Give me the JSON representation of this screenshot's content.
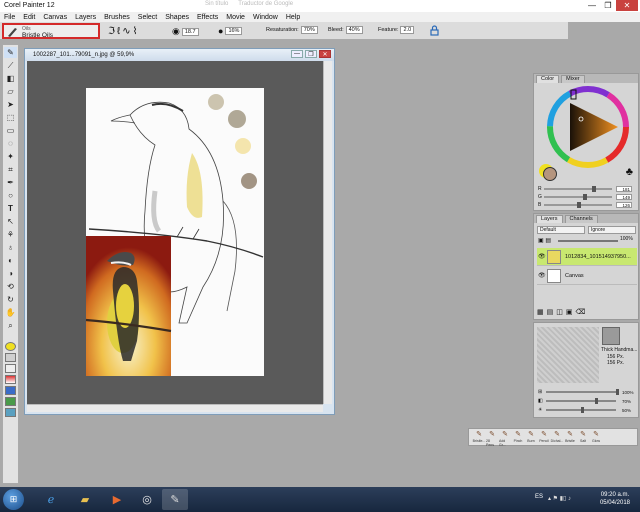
{
  "window": {
    "title": "Corel Painter 12",
    "ghost_tabs": [
      "Sin título",
      "Traductor de Google"
    ]
  },
  "window_controls": {
    "min": "—",
    "max": "❐",
    "close": "✕"
  },
  "menu": [
    "File",
    "Edit",
    "Canvas",
    "Layers",
    "Brushes",
    "Select",
    "Shapes",
    "Effects",
    "Movie",
    "Window",
    "Help"
  ],
  "propertybar": {
    "brush_category": "Oils",
    "brush_variant": "Bristle Oils",
    "size": "18.7",
    "opacity": "16%",
    "resaturation_label": "Resaturation:",
    "resaturation": "70%",
    "bleed_label": "Bleed:",
    "bleed": "40%",
    "feature_label": "Feature:",
    "feature": "2.0"
  },
  "document": {
    "title": "1002287_101...79091_n.jpg @ 59,9%",
    "controls": {
      "min": "—",
      "max": "❐",
      "close": "✕"
    }
  },
  "color_panel": {
    "tabs": [
      "Color",
      "Mixer"
    ],
    "rgb": [
      {
        "label": "R",
        "value": "181",
        "fraction": 0.71
      },
      {
        "label": "G",
        "value": "149",
        "fraction": 0.58
      },
      {
        "label": "B",
        "value": "126",
        "fraction": 0.49
      }
    ],
    "main_color": "#b5957e",
    "secondary_color": "#f0e020"
  },
  "layers_panel": {
    "tabs": [
      "Layers",
      "Channels"
    ],
    "composite_method": "Default",
    "composite_depth": "Ignore",
    "opacity": "100%",
    "layers": [
      {
        "name": "1012834_101514937950...",
        "selected": true
      },
      {
        "name": "Canvas",
        "selected": false
      }
    ]
  },
  "paper_panel": {
    "paper_name": "Thick Handma...",
    "width": "156 Px.",
    "height": "156 Px.",
    "scale": "100%",
    "contrast": "70%",
    "brightness": "50%"
  },
  "brush_strip": [
    "Bristle...",
    "28 Pens",
    "Add Gr...",
    "Pinch",
    "Burn",
    "Pencil",
    "Dichal...",
    "Bristle",
    "Salt",
    "Glow"
  ],
  "taskbar": {
    "start": "⊞",
    "lang": "ES",
    "time": "09:20 a.m.",
    "date": "05/04/2018"
  }
}
